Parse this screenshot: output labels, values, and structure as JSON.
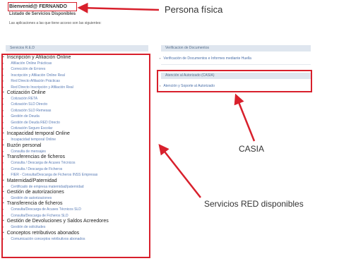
{
  "header": {
    "welcome": "Bienvenid@ FERNANDO",
    "list_title": "Listado de Servicios Disponibles",
    "intro": "Las aplicaciones a las que tiene acceso son las siguientes:"
  },
  "left_panel": {
    "title": "Servicios R.E.D",
    "sections": [
      {
        "label": "Inscripción y Afiliación Online",
        "items": [
          "Afiliación Online Prácticas",
          "Corrección de Errores",
          "Inscripción y Afiliación Online Real",
          "Red Directo Afiliación Prácticas",
          "Red Directo Inscripción y Afiliación Real"
        ]
      },
      {
        "label": "Cotización Online",
        "items": [
          "Cotización RETA",
          "Cotización SLD Directo",
          "Cotización SLD Remesas",
          "Gestión de Deuda",
          "Gestión de Deuda RED Directo",
          "Cotización Seguro Escolar"
        ]
      },
      {
        "label": "Incapacidad temporal Online",
        "items": [
          "Incapacidad temporal Online"
        ]
      },
      {
        "label": "Buzón personal",
        "items": [
          "Consulta de mensajes"
        ]
      },
      {
        "label": "Transferencias de ficheros",
        "items": [
          "Consulta / Descarga de Acuses Técnicos",
          "Consulta / Descarga de Ficheros",
          "FIER - Consulta/Descarga de Ficheros INSS Empresas"
        ]
      },
      {
        "label": "Maternidad/Paternidad",
        "items": [
          "Certificado de empresa maternidad/paternidad"
        ]
      },
      {
        "label": "Gestión de autorizaciones",
        "items": [
          "Gestión de autorizaciones"
        ]
      },
      {
        "label": "Transferencia de ficheros",
        "items": [
          "Consulta/Descarga de Acuses Técnicos SLD",
          "Consulta/Descarga de Ficheros SLD"
        ]
      },
      {
        "label": "Gestión de Devoluciones y Saldos Acreedores",
        "items": [
          "Gestión de solicitudes"
        ]
      },
      {
        "label": "Conceptos retributivos abonados",
        "items": [
          "Comunicación conceptos retributivos abonados"
        ]
      }
    ]
  },
  "right_panel": {
    "verify_title": "Verificacion de Documentos",
    "verify_item": "Verificación de Documentos e Informes mediante Huella",
    "casia_title": "Atención al Autorizado (CASIA)",
    "casia_item": "Atención y Soporte al Autorizado"
  },
  "callouts": {
    "persona": "Persona física",
    "casia": "CASIA",
    "red": "Servicios RED disponibles"
  },
  "colors": {
    "highlight": "#d8202c",
    "panel_header": "#dfe6ef",
    "link": "#5a7cb5"
  }
}
